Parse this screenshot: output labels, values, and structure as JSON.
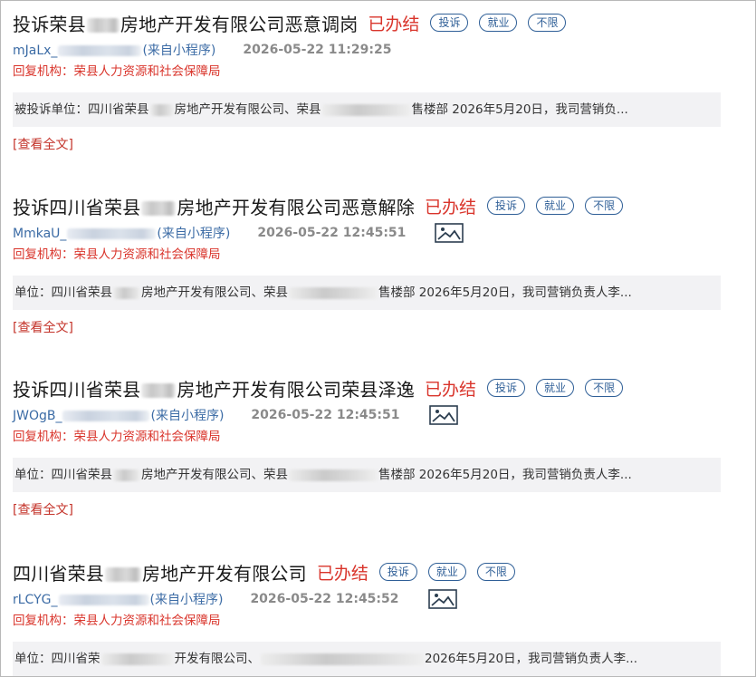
{
  "posts": [
    {
      "title_a": "投诉荣县",
      "title_b": "房地产开发有限公司恶意调岗",
      "status": "已办结",
      "tags": [
        "投诉",
        "就业",
        "不限"
      ],
      "user_prefix": "mJaLx_",
      "user_suffix": "(来自小程序)",
      "time": "2026-05-22 11:29:25",
      "has_image": false,
      "org": "回复机构：荣县人力资源和社会保障局",
      "excerpt_a": "被投诉单位：四川省荣县",
      "excerpt_b": "房地产开发有限公司、荣县",
      "excerpt_c": "售楼部 2026年5月20日，我司营销负...",
      "readmore": "[查看全文]"
    },
    {
      "title_a": "投诉四川省荣县",
      "title_b": "房地产开发有限公司恶意解除",
      "status": "已办结",
      "tags": [
        "投诉",
        "就业",
        "不限"
      ],
      "user_prefix": "MmkaU_",
      "user_suffix": "(来自小程序)",
      "time": "2026-05-22 12:45:51",
      "has_image": true,
      "org": "回复机构：荣县人力资源和社会保障局",
      "excerpt_a": "单位：四川省荣县",
      "excerpt_b": "房地产开发有限公司、荣县",
      "excerpt_c": "售楼部 2026年5月20日，我司营销负责人李...",
      "readmore": "[查看全文]"
    },
    {
      "title_a": "投诉四川省荣县",
      "title_b": "房地产开发有限公司荣县泽逸",
      "status": "已办结",
      "tags": [
        "投诉",
        "就业",
        "不限"
      ],
      "user_prefix": "JWOgB_",
      "user_suffix": "(来自小程序)",
      "time": "2026-05-22 12:45:51",
      "has_image": true,
      "org": "回复机构：荣县人力资源和社会保障局",
      "excerpt_a": "单位：四川省荣县",
      "excerpt_b": "房地产开发有限公司、荣县",
      "excerpt_c": "售楼部 2026年5月20日，我司营销负责人李...",
      "readmore": "[查看全文]"
    },
    {
      "title_a": "四川省荣县",
      "title_b": "房地产开发有限公司",
      "status": "已办结",
      "tags": [
        "投诉",
        "就业",
        "不限"
      ],
      "user_prefix": "rLCYG_",
      "user_suffix": "(来自小程序)",
      "time": "2026-05-22 12:45:52",
      "has_image": true,
      "org": "回复机构：荣县人力资源和社会保障局",
      "excerpt_a": "单位：四川省荣",
      "excerpt_b": "开发有限公司、",
      "excerpt_c": "2026年5月20日，我司营销负责人李...",
      "readmore": ""
    }
  ]
}
